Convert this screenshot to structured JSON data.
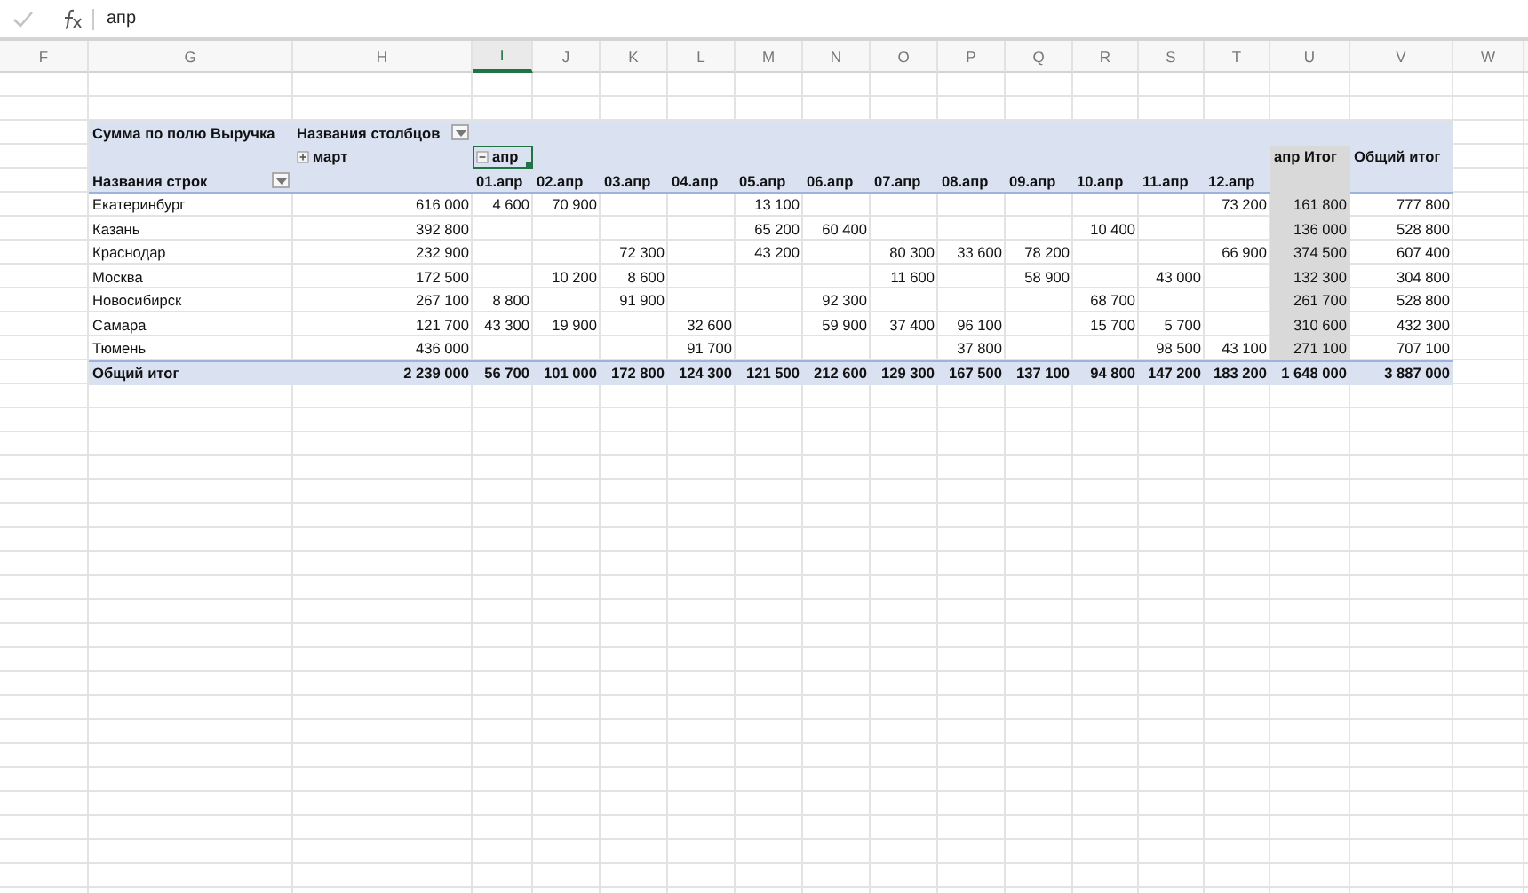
{
  "formula_bar": {
    "value": "апр"
  },
  "column_headers": [
    {
      "label": "F",
      "selected": false
    },
    {
      "label": "G",
      "selected": false
    },
    {
      "label": "H",
      "selected": false
    },
    {
      "label": "I",
      "selected": true
    },
    {
      "label": "J",
      "selected": false
    },
    {
      "label": "K",
      "selected": false
    },
    {
      "label": "L",
      "selected": false
    },
    {
      "label": "M",
      "selected": false
    },
    {
      "label": "N",
      "selected": false
    },
    {
      "label": "O",
      "selected": false
    },
    {
      "label": "P",
      "selected": false
    },
    {
      "label": "Q",
      "selected": false
    },
    {
      "label": "R",
      "selected": false
    },
    {
      "label": "S",
      "selected": false
    },
    {
      "label": "T",
      "selected": false
    },
    {
      "label": "U",
      "selected": false
    },
    {
      "label": "V",
      "selected": false
    },
    {
      "label": "W",
      "selected": false
    }
  ],
  "pivot": {
    "data_field_label": "Сумма по полю Выручка",
    "column_labels_label": "Названия столбцов",
    "row_labels_label": "Названия строк",
    "groups": [
      {
        "label": "март",
        "expanded": false,
        "selected": false
      },
      {
        "label": "апр",
        "expanded": true,
        "selected": true
      }
    ],
    "day_headers": [
      "01.апр",
      "02.апр",
      "03.апр",
      "04.апр",
      "05.апр",
      "06.апр",
      "07.апр",
      "08.апр",
      "09.апр",
      "10.апр",
      "11.апр",
      "12.апр"
    ],
    "subtotal_header": "апр Итог",
    "grand_total_header": "Общий итог",
    "rows": [
      {
        "label": "Екатеринбург",
        "values": [
          "616 000",
          "4 600",
          "70 900",
          {
            "blank": true
          },
          {
            "blank": true
          },
          "13 100",
          {
            "blank": true
          },
          {
            "blank": true
          },
          {
            "blank": true
          },
          {
            "blank": true
          },
          {
            "blank": true
          },
          {
            "blank": true
          },
          "73 200",
          "161 800",
          "777 800"
        ]
      },
      {
        "label": "Казань",
        "values": [
          "392 800",
          {
            "blank": true
          },
          {
            "blank": true
          },
          {
            "blank": true
          },
          {
            "blank": true
          },
          "65 200",
          "60 400",
          {
            "blank": true
          },
          {
            "blank": true
          },
          {
            "blank": true
          },
          "10 400",
          {
            "blank": true
          },
          {
            "blank": true
          },
          "136 000",
          "528 800"
        ]
      },
      {
        "label": "Краснодар",
        "values": [
          "232 900",
          {
            "blank": true
          },
          {
            "blank": true
          },
          "72 300",
          {
            "blank": true
          },
          "43 200",
          {
            "blank": true
          },
          "80 300",
          "33 600",
          "78 200",
          {
            "blank": true
          },
          {
            "blank": true
          },
          "66 900",
          "374 500",
          "607 400"
        ]
      },
      {
        "label": "Москва",
        "values": [
          "172 500",
          {
            "blank": true
          },
          "10 200",
          "8 600",
          {
            "blank": true
          },
          {
            "blank": true
          },
          {
            "blank": true
          },
          "11 600",
          {
            "blank": true
          },
          "58 900",
          {
            "blank": true
          },
          "43 000",
          {
            "blank": true
          },
          "132 300",
          "304 800"
        ]
      },
      {
        "label": "Новосибирск",
        "values": [
          "267 100",
          "8 800",
          {
            "blank": true
          },
          "91 900",
          {
            "blank": true
          },
          {
            "blank": true
          },
          "92 300",
          {
            "blank": true
          },
          {
            "blank": true
          },
          {
            "blank": true
          },
          "68 700",
          {
            "blank": true
          },
          {
            "blank": true
          },
          "261 700",
          "528 800"
        ]
      },
      {
        "label": "Самара",
        "values": [
          "121 700",
          "43 300",
          "19 900",
          {
            "blank": true
          },
          "32 600",
          {
            "blank": true
          },
          "59 900",
          "37 400",
          "96 100",
          {
            "blank": true
          },
          "15 700",
          "5 700",
          {
            "blank": true
          },
          "310 600",
          "432 300"
        ]
      },
      {
        "label": "Тюмень",
        "values": [
          "436 000",
          {
            "blank": true
          },
          {
            "blank": true
          },
          {
            "blank": true
          },
          "91 700",
          {
            "blank": true
          },
          {
            "blank": true
          },
          {
            "blank": true
          },
          "37 800",
          {
            "blank": true
          },
          {
            "blank": true
          },
          "98 500",
          "43 100",
          "271 100",
          "707 100"
        ]
      }
    ],
    "total": {
      "label": "Общий итог",
      "values": [
        "2 239 000",
        "56 700",
        "101 000",
        "172 800",
        "124 300",
        "121 500",
        "212 600",
        "129 300",
        "167 500",
        "137 100",
        "94 800",
        "147 200",
        "183 200",
        "1 648 000",
        "3 887 000"
      ]
    }
  }
}
